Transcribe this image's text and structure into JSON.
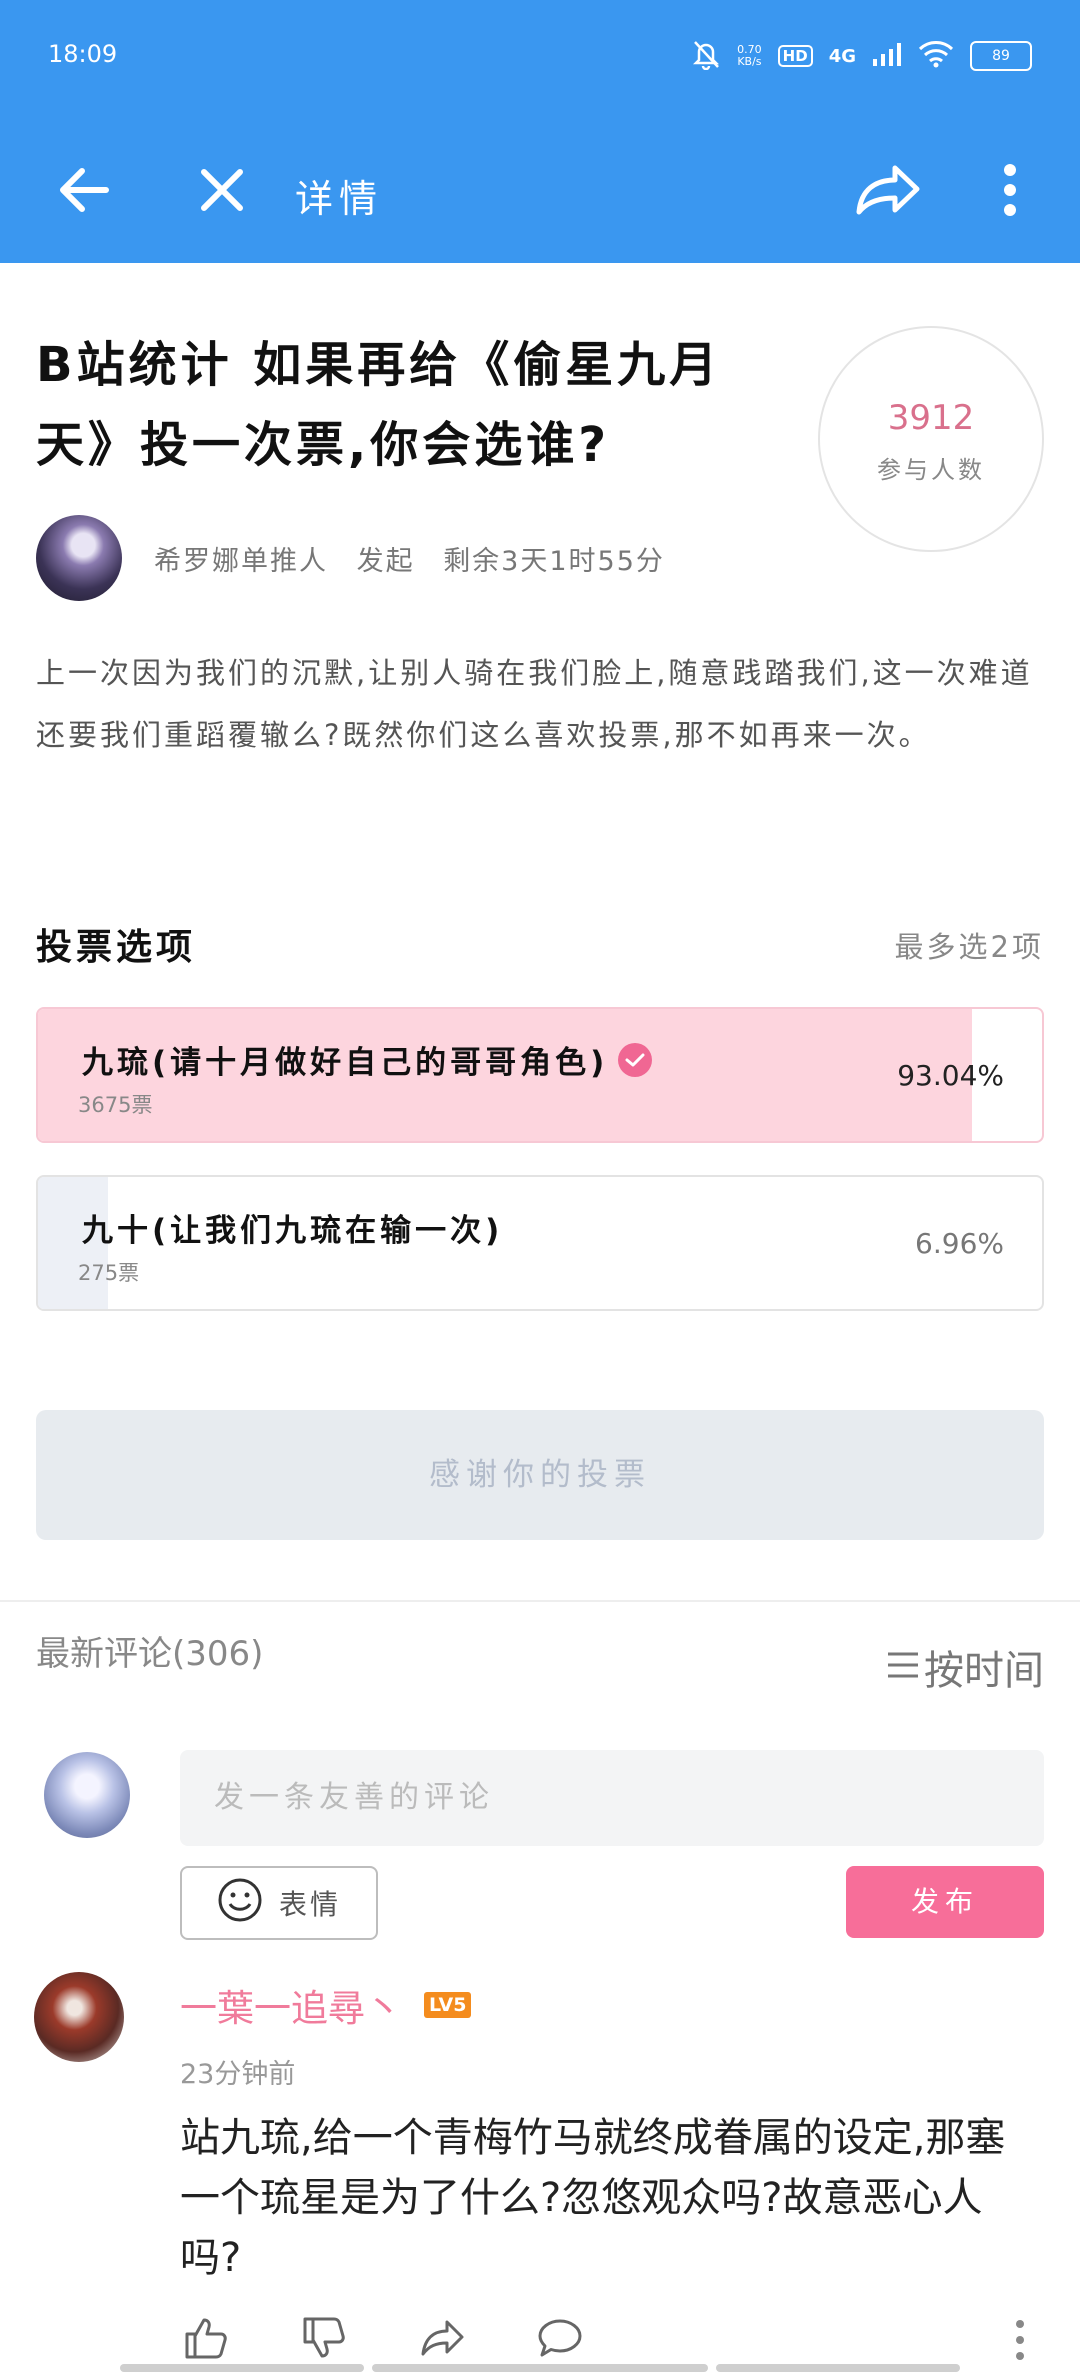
{
  "status_bar": {
    "time": "18:09",
    "net_speed_value": "0.70",
    "net_speed_unit": "KB/s",
    "hd": "HD",
    "network": "4G",
    "battery": "89"
  },
  "nav": {
    "title": "详情"
  },
  "poll": {
    "title": "B站统计 如果再给《偷星九月天》投一次票,你会选谁?",
    "participants_count": "3912",
    "participants_label": "参与人数",
    "author": "希罗娜单推人",
    "author_action": "发起",
    "time_left": "剩余3天1时55分",
    "description": "上一次因为我们的沉默,让别人骑在我们脸上,随意践踏我们,这一次难道还要我们重蹈覆辙么?既然你们这么喜欢投票,那不如再来一次。",
    "options_heading": "投票选项",
    "options_limit": "最多选2项",
    "options": [
      {
        "label": "九琉(请十月做好自己的哥哥角色)",
        "votes": "3675票",
        "percent": "93.04%",
        "fraction": 0.9304,
        "voted": true
      },
      {
        "label": "九十(让我们九琉在输一次)",
        "votes": "275票",
        "percent": "6.96%",
        "fraction": 0.0696,
        "voted": false
      }
    ],
    "thanks_button": "感谢你的投票"
  },
  "comments": {
    "heading": "最新评论(306)",
    "sort_label": "按时间",
    "input_placeholder": "发一条友善的评论",
    "emoji_button": "表情",
    "publish_button": "发布",
    "items": [
      {
        "username": "一葉一追尋丶",
        "level": "LV5",
        "time": "23分钟前",
        "text": "站九琉,给一个青梅竹马就终成眷属的设定,那塞一个琉星是为了什么?忽悠观众吗?故意恶心人吗?"
      }
    ]
  },
  "colors": {
    "primary": "#3a97f0",
    "pink": "#f76e99",
    "voted_fill": "#fdd5de",
    "participants_num": "#d9708c"
  }
}
